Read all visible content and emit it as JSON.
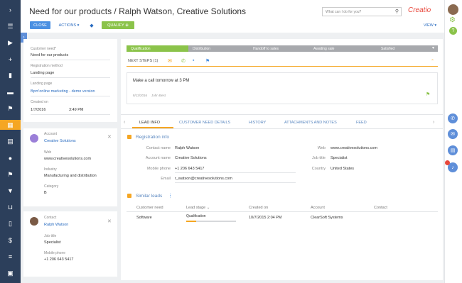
{
  "header": {
    "title": "Need for our products / Ralph Watson, Creative Solutions",
    "search_placeholder": "What can I do for you?",
    "close": "CLOSE",
    "actions": "ACTIONS",
    "qualify": "QUALIFY",
    "view": "VIEW",
    "logo": "Creatio"
  },
  "colors": {
    "nav": "#2c3f5b",
    "accent_green": "#8bc34a",
    "link": "#2a6cc0",
    "orange": "#f5a623"
  },
  "nav_icons": [
    "chevron-right-icon",
    "menu-icon",
    "play-icon",
    "plus-icon",
    "chart-icon",
    "chat-icon",
    "flag-icon",
    "building-icon",
    "calendar-icon",
    "user-icon",
    "flag-icon",
    "funnel-icon",
    "cart-icon",
    "document-icon",
    "dollar-document-icon",
    "list-icon",
    "briefcase-icon"
  ],
  "lead": {
    "need_label": "Customer need*",
    "need": "Need for our products",
    "reg_label": "Registration method",
    "reg": "Landing page",
    "lp_label": "Landing page",
    "lp": "Bpm'online marketing - demo version",
    "created_label": "Created on",
    "created_date": "1/7/2016",
    "created_time": "3:49 PM"
  },
  "account": {
    "heading": "Account",
    "name": "Creative Solutions",
    "web_label": "Web",
    "web": "www.creativesolutions.com",
    "ind_label": "Industry",
    "ind": "Manufacturing and distribution",
    "cat_label": "Category",
    "cat": "B"
  },
  "contact": {
    "heading": "Contact",
    "name": "Ralph Watson",
    "job_label": "Job title",
    "job": "Specialist",
    "mob_label": "Mobile phone",
    "mob": "+1 206 643 5417"
  },
  "stages": [
    "Qualification",
    "Distribution",
    "Handoff to sales",
    "Awaiting sale",
    "Satisfied"
  ],
  "next_steps": {
    "label": "NEXT STEPS (1)",
    "task": "Make a call tomorrow at 3 PM",
    "date": "8/12/2016",
    "owner": "John Best"
  },
  "tabs": [
    "LEAD INFO",
    "CUSTOMER NEED DETAILS",
    "HISTORY",
    "ATTACHMENTS AND NOTES",
    "FEED"
  ],
  "reg": {
    "title": "Registration info",
    "contact_name_label": "Contact name",
    "contact_name": "Ralph Watson",
    "account_name_label": "Account name",
    "account_name": "Creative Solutions",
    "mobile_label": "Mobile phone",
    "mobile": "+1 206 643 5417",
    "email_label": "Email",
    "email": "r_watson@creativesolutions.com",
    "web_label": "Web",
    "web": "www.creativesolutions.com",
    "job_label": "Job title",
    "job": "Specialist",
    "country_label": "Country",
    "country": "United States"
  },
  "similar": {
    "title": "Similar leads",
    "cols": [
      "Customer need",
      "Lead stage",
      "Created on",
      "Account",
      "Contact"
    ],
    "row": {
      "need": "Software",
      "stage": "Qualification",
      "created": "10/7/2015 2:04 PM",
      "account": "ClearSoft Systems",
      "contact": ""
    }
  }
}
